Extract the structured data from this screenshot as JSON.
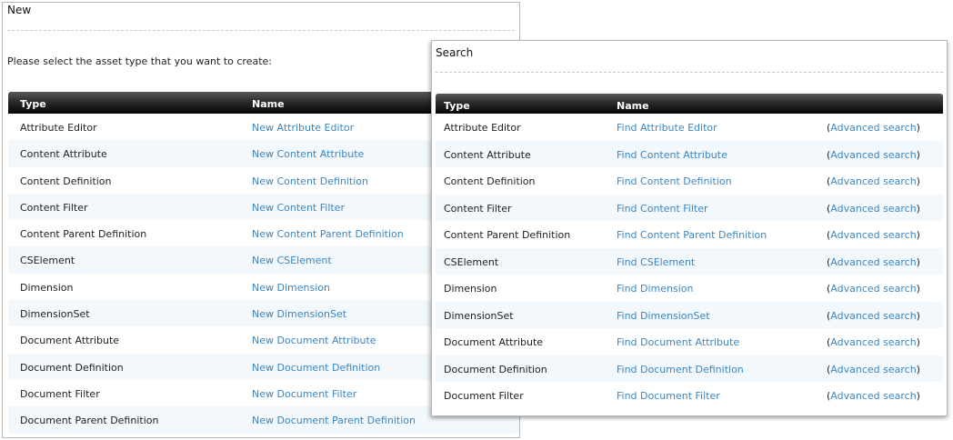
{
  "new_panel": {
    "title": "New",
    "prompt": "Please select the asset type that you want to create:",
    "headers": {
      "type": "Type",
      "name": "Name"
    },
    "rows": [
      {
        "type": "Attribute Editor",
        "name": "New Attribute Editor"
      },
      {
        "type": "Content Attribute",
        "name": "New Content Attribute"
      },
      {
        "type": "Content Definition",
        "name": "New Content Definition"
      },
      {
        "type": "Content Filter",
        "name": "New Content Filter"
      },
      {
        "type": "Content Parent Definition",
        "name": "New Content Parent Definition"
      },
      {
        "type": "CSElement",
        "name": "New CSElement"
      },
      {
        "type": "Dimension",
        "name": "New Dimension"
      },
      {
        "type": "DimensionSet",
        "name": "New DimensionSet"
      },
      {
        "type": "Document Attribute",
        "name": "New Document Attribute"
      },
      {
        "type": "Document Definition",
        "name": "New Document Definition"
      },
      {
        "type": "Document Filter",
        "name": "New Document Filter"
      },
      {
        "type": "Document Parent Definition",
        "name": "New Document Parent Definition"
      }
    ]
  },
  "search_panel": {
    "title": "Search",
    "headers": {
      "type": "Type",
      "name": "Name"
    },
    "advanced_label": "Advanced search",
    "paren_open": "(",
    "paren_close": ")",
    "rows": [
      {
        "type": "Attribute Editor",
        "name": "Find Attribute Editor"
      },
      {
        "type": "Content Attribute",
        "name": "Find Content Attribute"
      },
      {
        "type": "Content Definition",
        "name": "Find Content Definition"
      },
      {
        "type": "Content Filter",
        "name": "Find Content Filter"
      },
      {
        "type": "Content Parent Definition",
        "name": "Find Content Parent Definition"
      },
      {
        "type": "CSElement",
        "name": "Find CSElement"
      },
      {
        "type": "Dimension",
        "name": "Find Dimension"
      },
      {
        "type": "DimensionSet",
        "name": "Find DimensionSet"
      },
      {
        "type": "Document Attribute",
        "name": "Find Document Attribute"
      },
      {
        "type": "Document Definition",
        "name": "Find Document Definition"
      },
      {
        "type": "Document Filter",
        "name": "Find Document Filter"
      }
    ]
  },
  "colors": {
    "link": "#3a86c4",
    "header_bg": "#1a1a1a",
    "row_alt": "#f2f8fb"
  }
}
